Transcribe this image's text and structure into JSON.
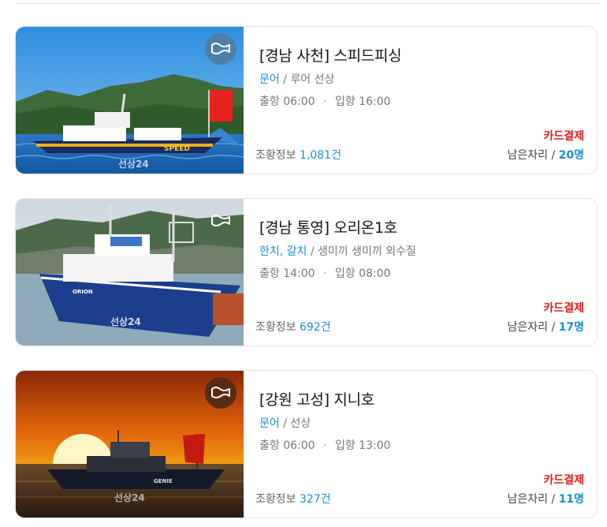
{
  "listings": [
    {
      "title": "[경남 사천] 스피드피싱",
      "fish": "문어",
      "method": "루어 선상",
      "depart_label": "출항",
      "depart_time": "06:00",
      "return_label": "입항",
      "return_time": "16:00",
      "payment": "카드결제",
      "views_label": "조황정보",
      "views_count": "1,081건",
      "seats_label": "남은자리",
      "seats_count": "20명",
      "watermark": "선상24",
      "boat_name": "SPEED"
    },
    {
      "title": "[경남 통영] 오리온1호",
      "fish": "한치, 갈치",
      "method": "생미끼 생미끼 외수질",
      "depart_label": "출항",
      "depart_time": "14:00",
      "return_label": "입항",
      "return_time": "08:00",
      "payment": "카드결제",
      "views_label": "조황정보",
      "views_count": "692건",
      "seats_label": "남은자리",
      "seats_count": "17명",
      "watermark": "선상24",
      "boat_name": "ORION"
    },
    {
      "title": "[강원 고성] 지니호",
      "fish": "문어",
      "method": "선상",
      "depart_label": "출항",
      "depart_time": "06:00",
      "return_label": "입항",
      "return_time": "13:00",
      "payment": "카드결제",
      "views_label": "조황정보",
      "views_count": "327건",
      "seats_label": "남은자리",
      "seats_count": "11명",
      "watermark": "선상24",
      "boat_name": "GENIE"
    }
  ],
  "colors": {
    "accent": "#1a8fd6",
    "payment": "#e21b1b",
    "border": "#e3e6ea"
  },
  "icons": {
    "favorite": "wave-flag-icon"
  }
}
